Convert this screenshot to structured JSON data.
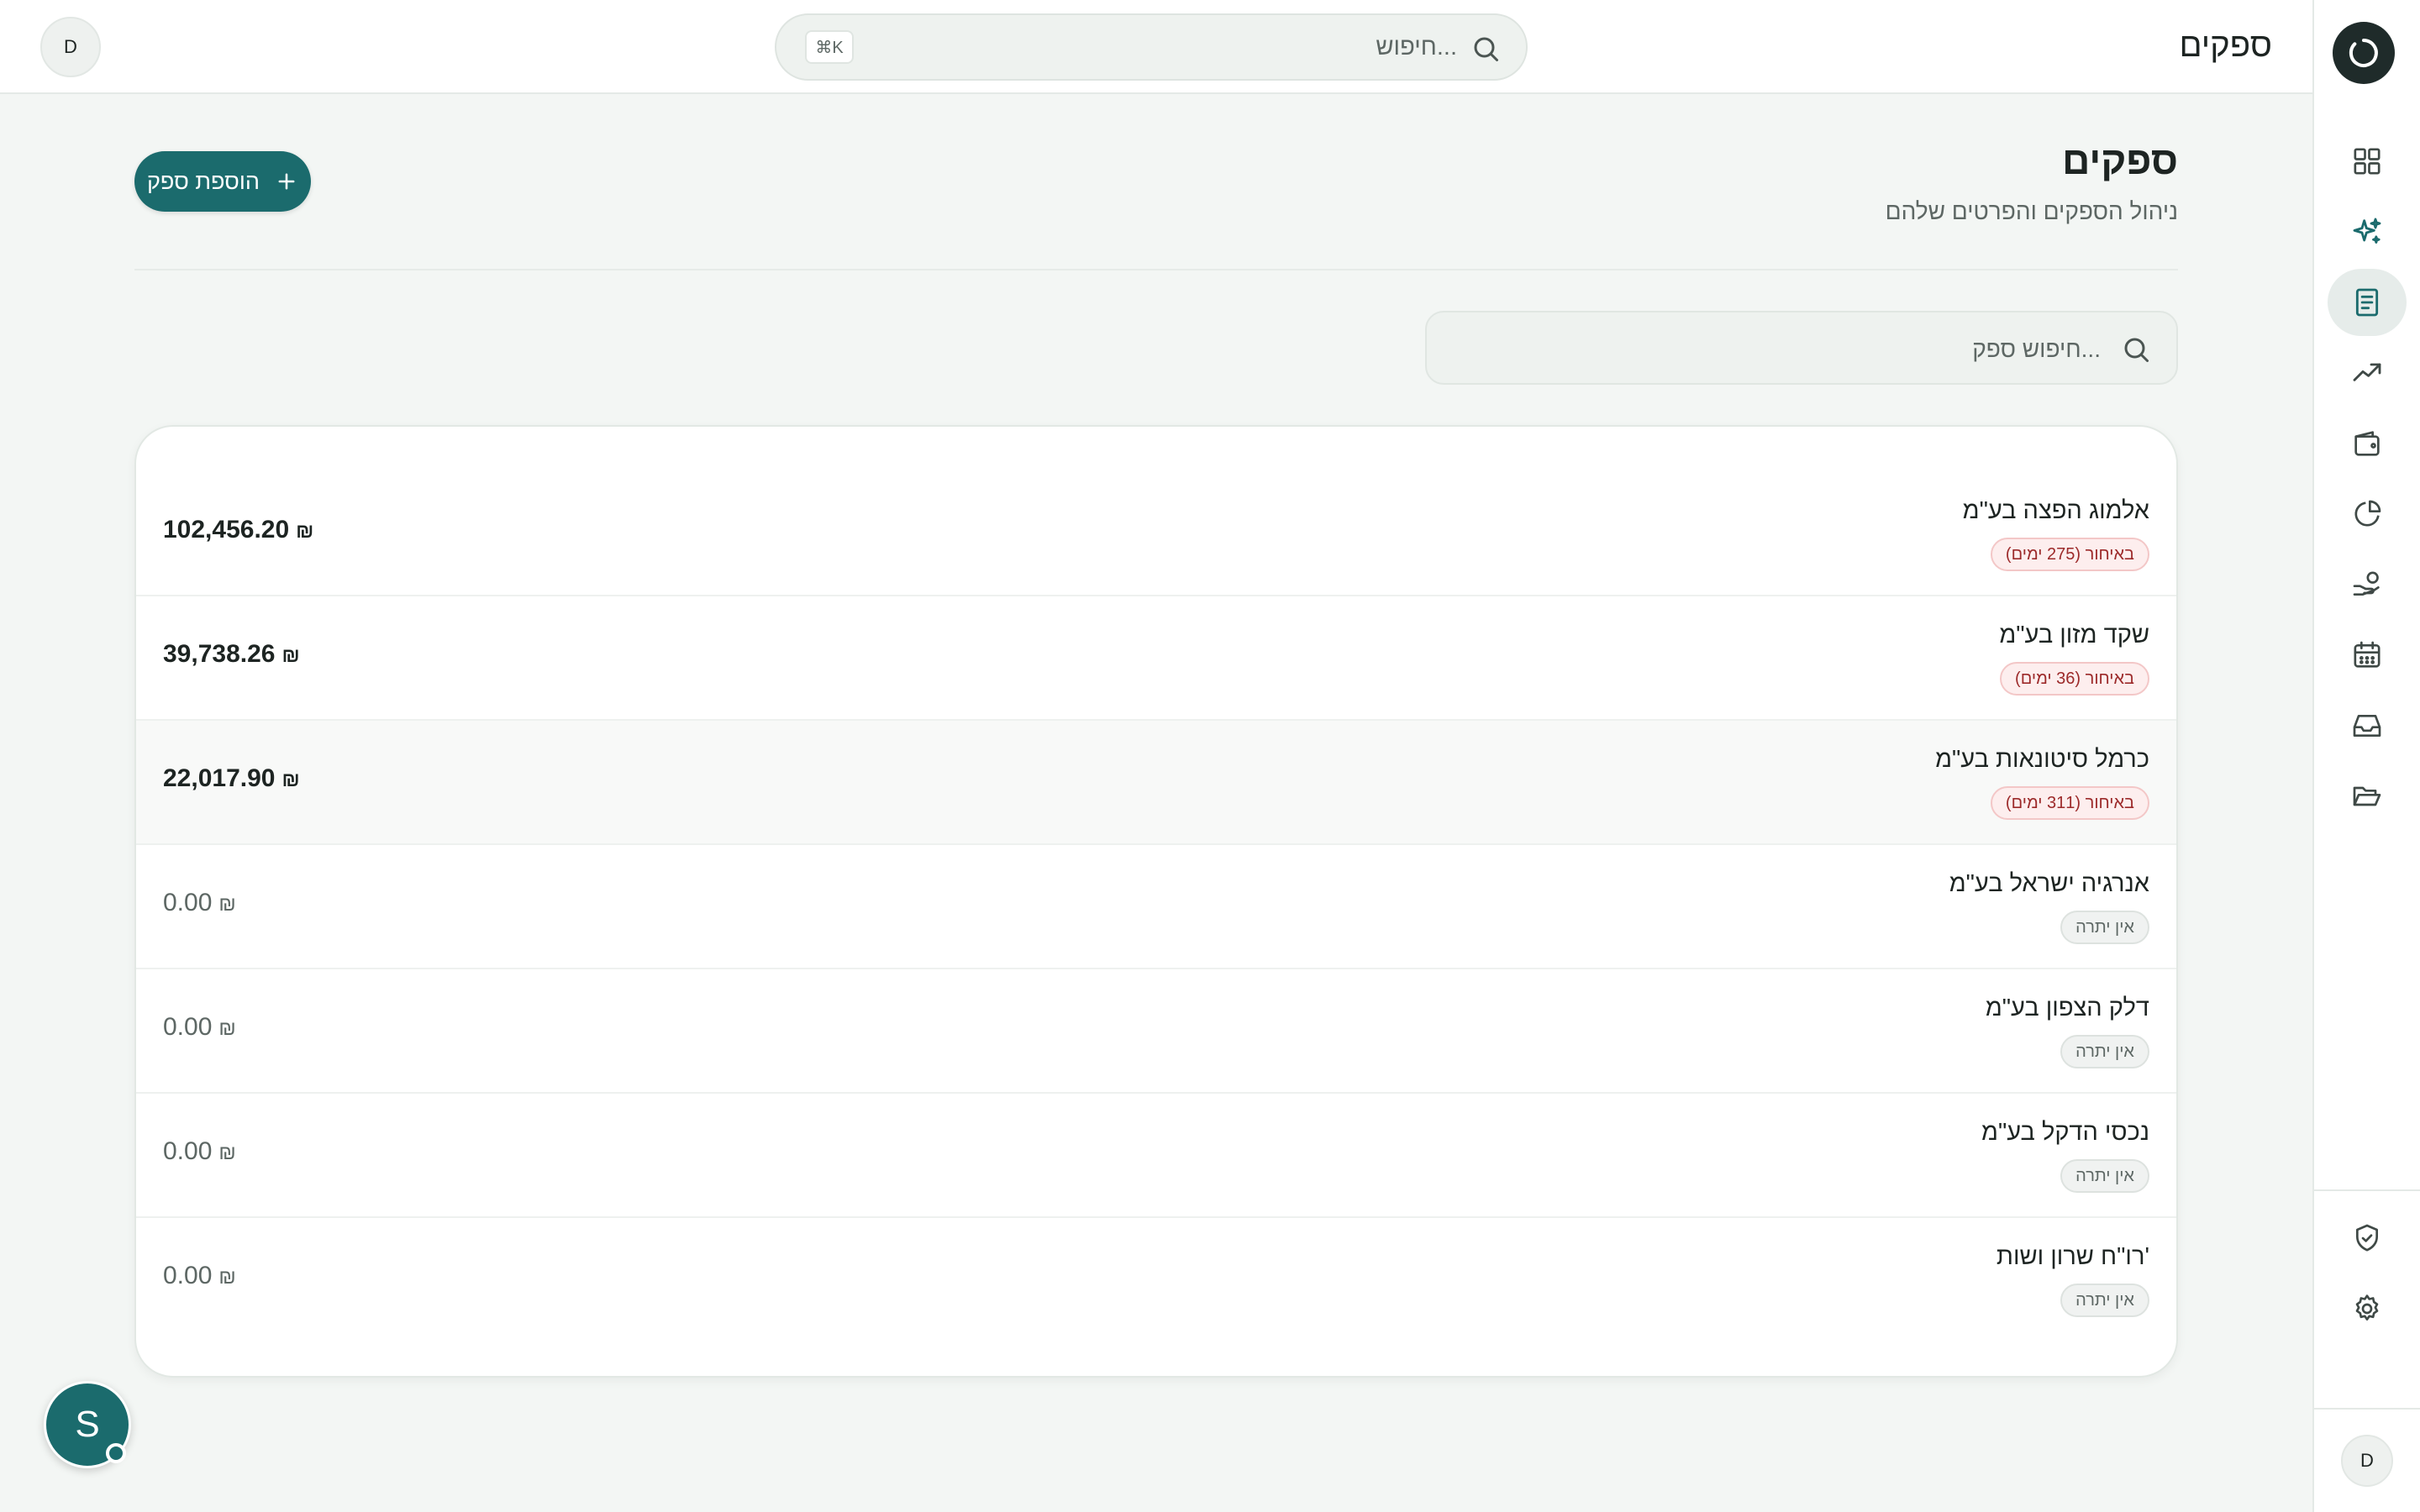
{
  "header": {
    "title": "ספקים",
    "search_placeholder": "חיפוש...",
    "shortcut": "⌘K",
    "avatar_initial": "D"
  },
  "sidebar": {
    "items": [
      {
        "name": "dashboard",
        "icon": "grid-icon",
        "active": false
      },
      {
        "name": "ai",
        "icon": "sparkles-icon",
        "active": false
      },
      {
        "name": "suppliers",
        "icon": "receipt-icon",
        "active": true
      },
      {
        "name": "trends",
        "icon": "trending-up-icon",
        "active": false
      },
      {
        "name": "wallet",
        "icon": "wallet-icon",
        "active": false
      },
      {
        "name": "reports",
        "icon": "pie-chart-icon",
        "active": false
      },
      {
        "name": "payments",
        "icon": "hand-coins-icon",
        "active": false
      },
      {
        "name": "calendar",
        "icon": "calendar-icon",
        "active": false
      },
      {
        "name": "inbox",
        "icon": "inbox-icon",
        "active": false
      },
      {
        "name": "documents",
        "icon": "folder-open-icon",
        "active": false
      }
    ],
    "bottom_items": [
      {
        "name": "security",
        "icon": "shield-check-icon"
      },
      {
        "name": "settings",
        "icon": "gear-icon"
      }
    ],
    "avatar_initial": "D"
  },
  "page": {
    "title": "ספקים",
    "subtitle": "ניהול הספקים והפרטים שלהם",
    "add_button_label": "הוספת ספק",
    "search_placeholder": "חיפוש ספק..."
  },
  "suppliers": [
    {
      "name": "אלמוג הפצה בע\"מ",
      "status": "באיחור (275 ימים)",
      "status_type": "overdue",
      "amount": "102,456.20",
      "currency": "₪"
    },
    {
      "name": "שקד מזון בע\"מ",
      "status": "באיחור (36 ימים)",
      "status_type": "overdue",
      "amount": "39,738.26",
      "currency": "₪"
    },
    {
      "name": "כרמל סיטונאות בע\"מ",
      "status": "באיחור (311 ימים)",
      "status_type": "overdue",
      "amount": "22,017.90",
      "currency": "₪"
    },
    {
      "name": "אנרגיה ישראל בע\"מ",
      "status": "אין יתרה",
      "status_type": "none",
      "amount": "0.00",
      "currency": "₪"
    },
    {
      "name": "דלק הצפון בע\"מ",
      "status": "אין יתרה",
      "status_type": "none",
      "amount": "0.00",
      "currency": "₪"
    },
    {
      "name": "נכסי הדקל בע\"מ",
      "status": "אין יתרה",
      "status_type": "none",
      "amount": "0.00",
      "currency": "₪"
    },
    {
      "name": "רו\"ח שרון ושות'",
      "status": "אין יתרה",
      "status_type": "none",
      "amount": "0.00",
      "currency": "₪"
    }
  ],
  "chat": {
    "initial": "S"
  },
  "colors": {
    "accent": "#1b6b6d",
    "overdue": "#9c2a2a",
    "background": "#f3f6f4"
  }
}
